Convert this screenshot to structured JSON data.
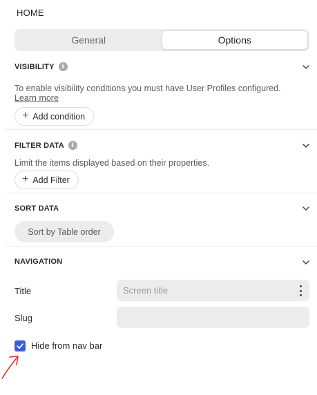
{
  "page": {
    "title": "HOME"
  },
  "tabs": [
    {
      "label": "General",
      "active": false
    },
    {
      "label": "Options",
      "active": true
    }
  ],
  "visibility": {
    "title": "VISIBILITY",
    "description": "To enable visibility conditions you must have User Profiles configured.",
    "link": "Learn more",
    "button": "Add condition"
  },
  "filter": {
    "title": "FILTER DATA",
    "description": "Limit the items displayed based on their properties.",
    "button": "Add Filter"
  },
  "sort": {
    "title": "SORT DATA",
    "button": "Sort by Table order"
  },
  "navigation": {
    "title": "NAVIGATION",
    "title_label": "Title",
    "title_placeholder": "Screen title",
    "title_value": "",
    "slug_label": "Slug",
    "slug_value": "",
    "hide_label": "Hide from nav bar",
    "hide_checked": true
  },
  "colors": {
    "accent": "#3b5bdb",
    "annotation": "#e0312b"
  }
}
